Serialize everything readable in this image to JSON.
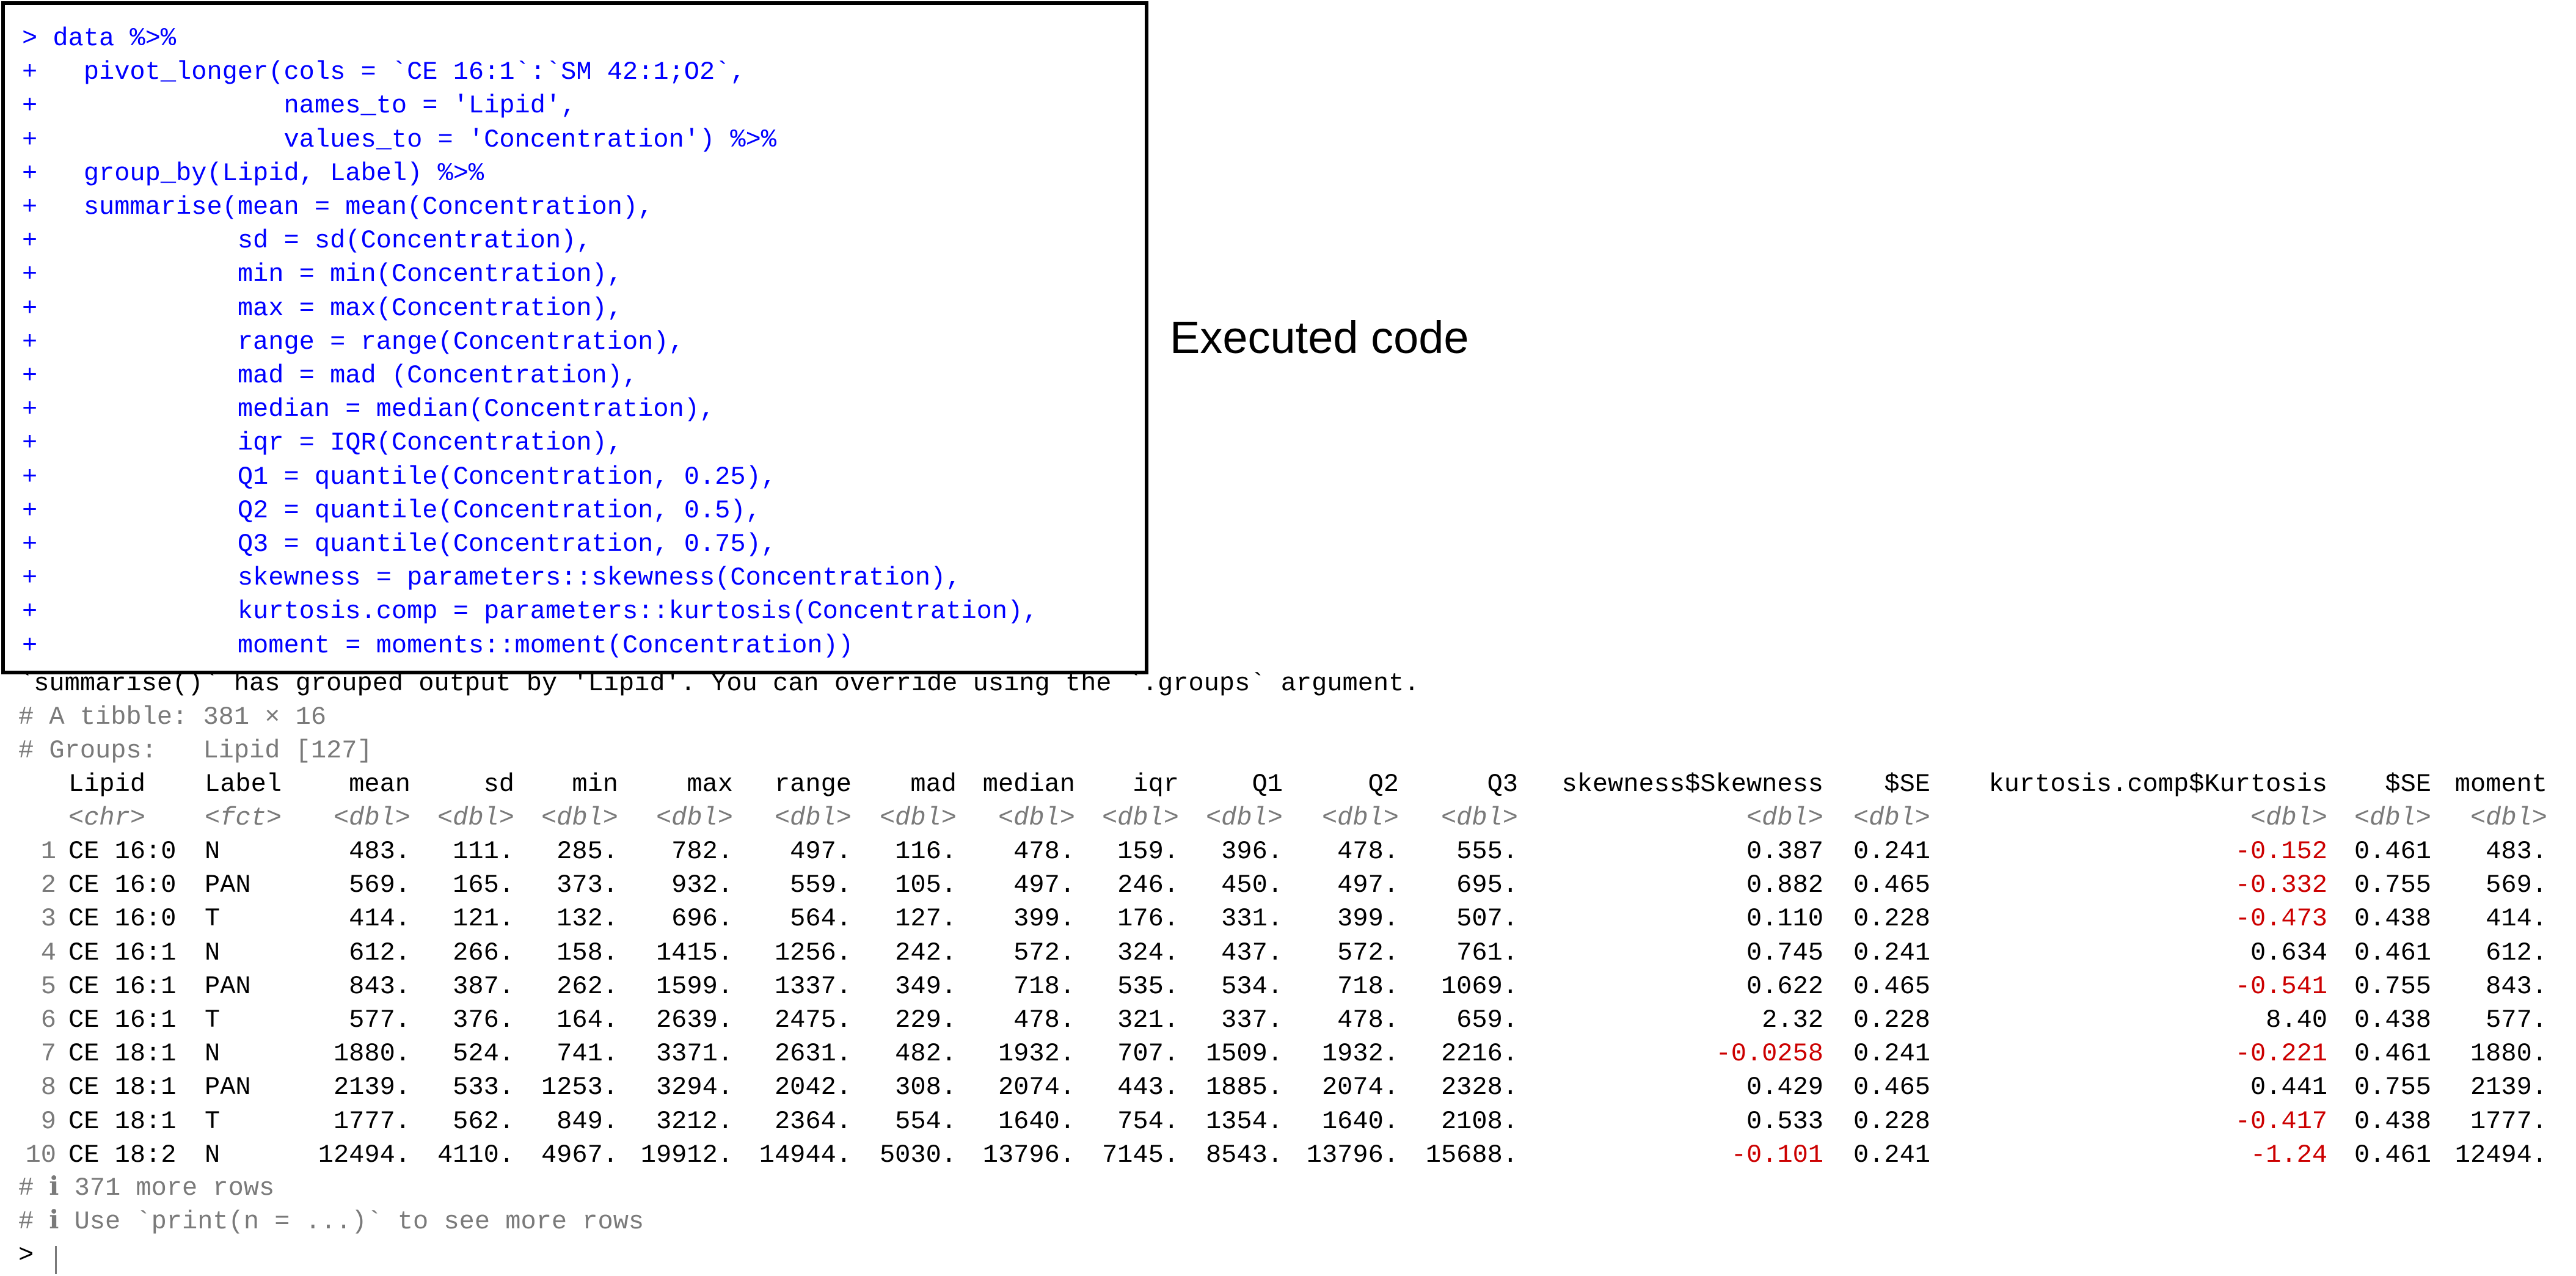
{
  "caption": "Executed code",
  "code_lines": [
    "> data %>%",
    "+   pivot_longer(cols = `CE 16:1`:`SM 42:1;O2`,",
    "+                names_to = 'Lipid',",
    "+                values_to = 'Concentration') %>%",
    "+   group_by(Lipid, Label) %>%",
    "+   summarise(mean = mean(Concentration),",
    "+             sd = sd(Concentration),",
    "+             min = min(Concentration),",
    "+             max = max(Concentration),",
    "+             range = range(Concentration),",
    "+             mad = mad (Concentration),",
    "+             median = median(Concentration),",
    "+             iqr = IQR(Concentration),",
    "+             Q1 = quantile(Concentration, 0.25),",
    "+             Q2 = quantile(Concentration, 0.5),",
    "+             Q3 = quantile(Concentration, 0.75),",
    "+             skewness = parameters::skewness(Concentration),",
    "+             kurtosis.comp = parameters::kurtosis(Concentration),",
    "+             moment = moments::moment(Concentration))"
  ],
  "message": "`summarise()` has grouped output by 'Lipid'. You can override using the `.groups` argument.",
  "tibble_info": "# A tibble: 381 × 16",
  "groups_info": "# Groups:   Lipid [127]",
  "table": {
    "headers": [
      "Lipid",
      "Label",
      "mean",
      "sd",
      "min",
      "max",
      "range",
      "mad",
      "median",
      "iqr",
      "Q1",
      "Q2",
      "Q3",
      "skewness$Skewness",
      "$SE",
      "kurtosis.comp$Kurtosis",
      "$SE",
      "moment"
    ],
    "types": [
      "<chr>",
      "<fct>",
      "<dbl>",
      "<dbl>",
      "<dbl>",
      "<dbl>",
      "<dbl>",
      "<dbl>",
      "<dbl>",
      "<dbl>",
      "<dbl>",
      "<dbl>",
      "<dbl>",
      "<dbl>",
      "<dbl>",
      "<dbl>",
      "<dbl>",
      "<dbl>"
    ],
    "rows": [
      [
        "1",
        "CE 16:0",
        "N",
        "483.",
        "111.",
        "285.",
        "782.",
        "497.",
        "116.",
        "478.",
        "159.",
        "396.",
        "478.",
        "555.",
        "0.387",
        "0.241",
        "-0.152",
        "0.461",
        "483."
      ],
      [
        "2",
        "CE 16:0",
        "PAN",
        "569.",
        "165.",
        "373.",
        "932.",
        "559.",
        "105.",
        "497.",
        "246.",
        "450.",
        "497.",
        "695.",
        "0.882",
        "0.465",
        "-0.332",
        "0.755",
        "569."
      ],
      [
        "3",
        "CE 16:0",
        "T",
        "414.",
        "121.",
        "132.",
        "696.",
        "564.",
        "127.",
        "399.",
        "176.",
        "331.",
        "399.",
        "507.",
        "0.110",
        "0.228",
        "-0.473",
        "0.438",
        "414."
      ],
      [
        "4",
        "CE 16:1",
        "N",
        "612.",
        "266.",
        "158.",
        "1415.",
        "1256.",
        "242.",
        "572.",
        "324.",
        "437.",
        "572.",
        "761.",
        "0.745",
        "0.241",
        "0.634",
        "0.461",
        "612."
      ],
      [
        "5",
        "CE 16:1",
        "PAN",
        "843.",
        "387.",
        "262.",
        "1599.",
        "1337.",
        "349.",
        "718.",
        "535.",
        "534.",
        "718.",
        "1069.",
        "0.622",
        "0.465",
        "-0.541",
        "0.755",
        "843."
      ],
      [
        "6",
        "CE 16:1",
        "T",
        "577.",
        "376.",
        "164.",
        "2639.",
        "2475.",
        "229.",
        "478.",
        "321.",
        "337.",
        "478.",
        "659.",
        "2.32",
        "0.228",
        "8.40",
        "0.438",
        "577."
      ],
      [
        "7",
        "CE 18:1",
        "N",
        "1880.",
        "524.",
        "741.",
        "3371.",
        "2631.",
        "482.",
        "1932.",
        "707.",
        "1509.",
        "1932.",
        "2216.",
        "-0.0258",
        "0.241",
        "-0.221",
        "0.461",
        "1880."
      ],
      [
        "8",
        "CE 18:1",
        "PAN",
        "2139.",
        "533.",
        "1253.",
        "3294.",
        "2042.",
        "308.",
        "2074.",
        "443.",
        "1885.",
        "2074.",
        "2328.",
        "0.429",
        "0.465",
        "0.441",
        "0.755",
        "2139."
      ],
      [
        "9",
        "CE 18:1",
        "T",
        "1777.",
        "562.",
        "849.",
        "3212.",
        "2364.",
        "554.",
        "1640.",
        "754.",
        "1354.",
        "1640.",
        "2108.",
        "0.533",
        "0.228",
        "-0.417",
        "0.438",
        "1777."
      ],
      [
        "10",
        "CE 18:2",
        "N",
        "12494.",
        "4110.",
        "4967.",
        "19912.",
        "14944.",
        "5030.",
        "13796.",
        "7145.",
        "8543.",
        "13796.",
        "15688.",
        "-0.101",
        "0.241",
        "-1.24",
        "0.461",
        "12494."
      ]
    ]
  },
  "footer_lines": [
    "# ℹ 371 more rows",
    "# ℹ Use `print(n = ...)` to see more rows"
  ],
  "prompt": ">",
  "colors": {
    "code": "#0000ff",
    "comment": "#7a7a7a",
    "negative": "#cc0000",
    "text": "#000000"
  }
}
